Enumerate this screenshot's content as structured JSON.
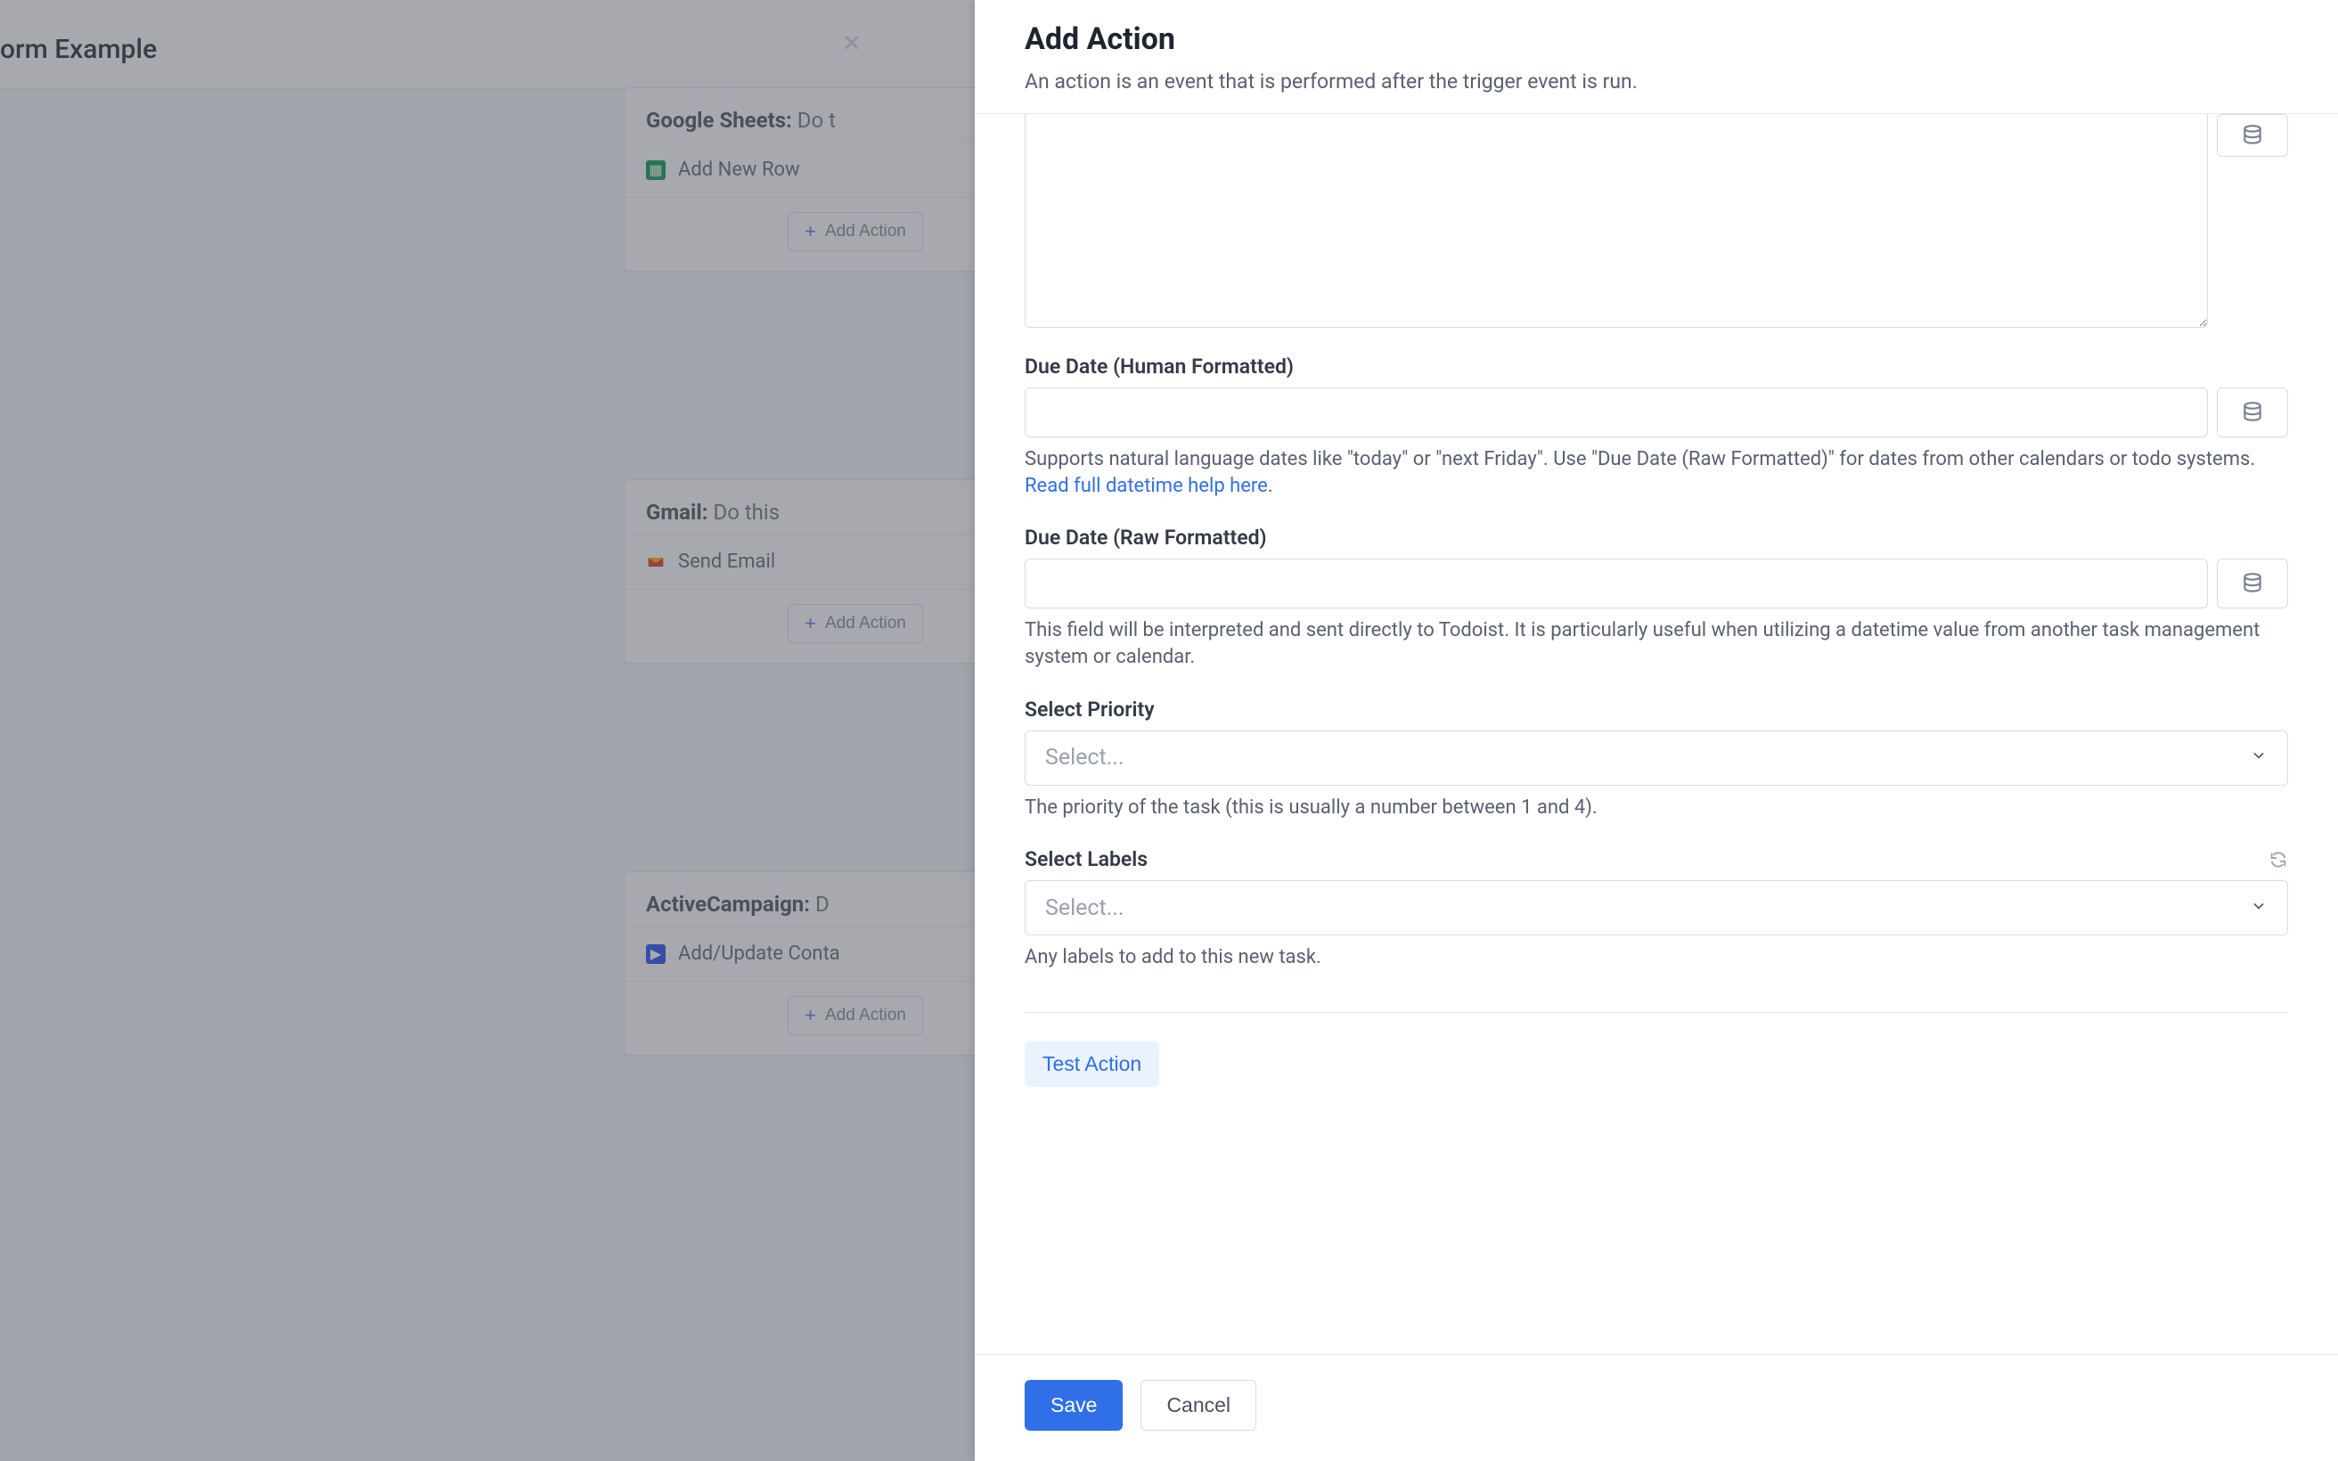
{
  "background": {
    "page_title": "orm Example",
    "close_icon": "×",
    "cards": [
      {
        "service": "Google Sheets:",
        "suffix": "Do t",
        "row_label": "Add New Row",
        "add_action": "Add Action",
        "icon": "sheets"
      },
      {
        "service": "Gmail:",
        "suffix": "Do this",
        "row_label": "Send Email",
        "add_action": "Add Action",
        "icon": "gmail"
      },
      {
        "service": "ActiveCampaign:",
        "suffix": "D",
        "row_label": "Add/Update Conta",
        "add_action": "Add Action",
        "icon": "ac"
      }
    ]
  },
  "panel": {
    "title": "Add Action",
    "subtitle": "An action is an event that is performed after the trigger event is run.",
    "fields": {
      "due_human": {
        "label": "Due Date (Human Formatted)",
        "helper_pre": "Supports natural language dates like \"today\" or \"next Friday\". Use \"Due Date (Raw Formatted)\" for dates from other calendars or todo systems. ",
        "helper_link": "Read full datetime help here",
        "helper_post": "."
      },
      "due_raw": {
        "label": "Due Date (Raw Formatted)",
        "helper": "This field will be interpreted and sent directly to Todoist. It is particularly useful when utilizing a datetime value from another task management system or calendar."
      },
      "priority": {
        "label": "Select Priority",
        "placeholder": "Select...",
        "helper": "The priority of the task (this is usually a number between 1 and 4)."
      },
      "labels": {
        "label": "Select Labels",
        "placeholder": "Select...",
        "helper": "Any labels to add to this new task."
      }
    },
    "test_action": "Test Action",
    "save": "Save",
    "cancel": "Cancel"
  }
}
